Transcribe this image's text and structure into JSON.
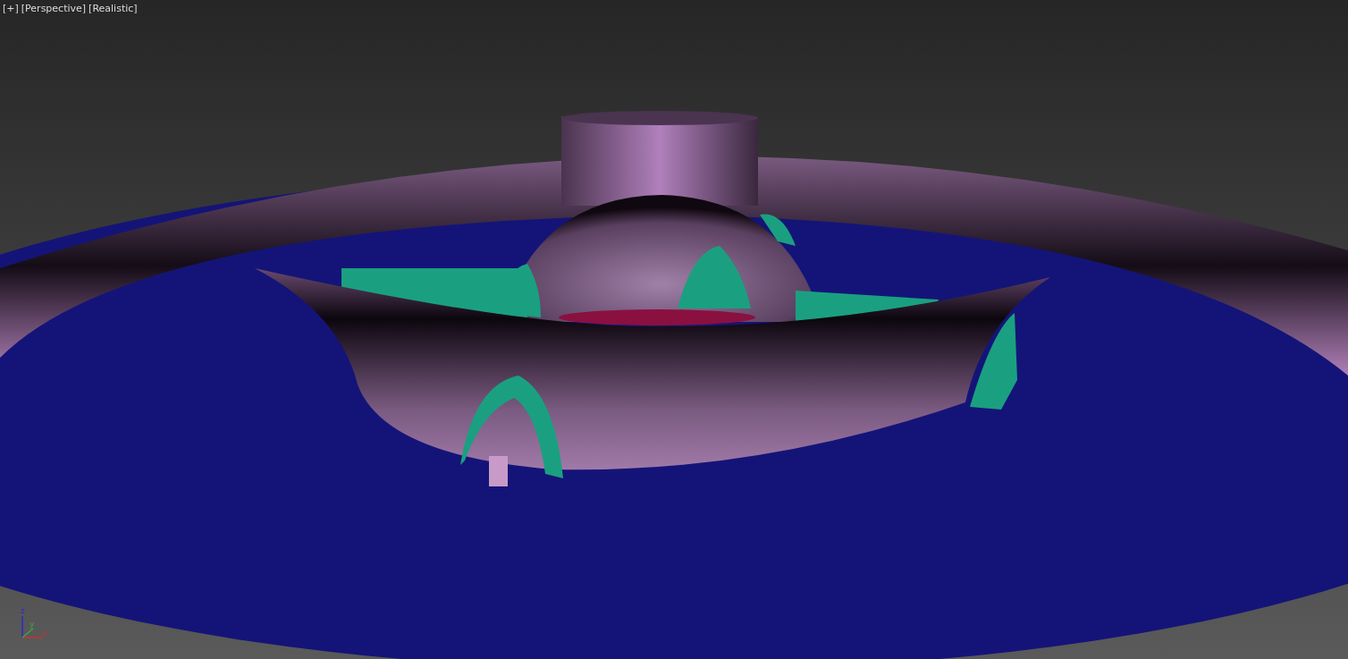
{
  "viewport": {
    "labels": [
      "[+]",
      "[Perspective]",
      "[Realistic]"
    ],
    "axis_labels": [
      "z",
      "y",
      "x"
    ]
  }
}
